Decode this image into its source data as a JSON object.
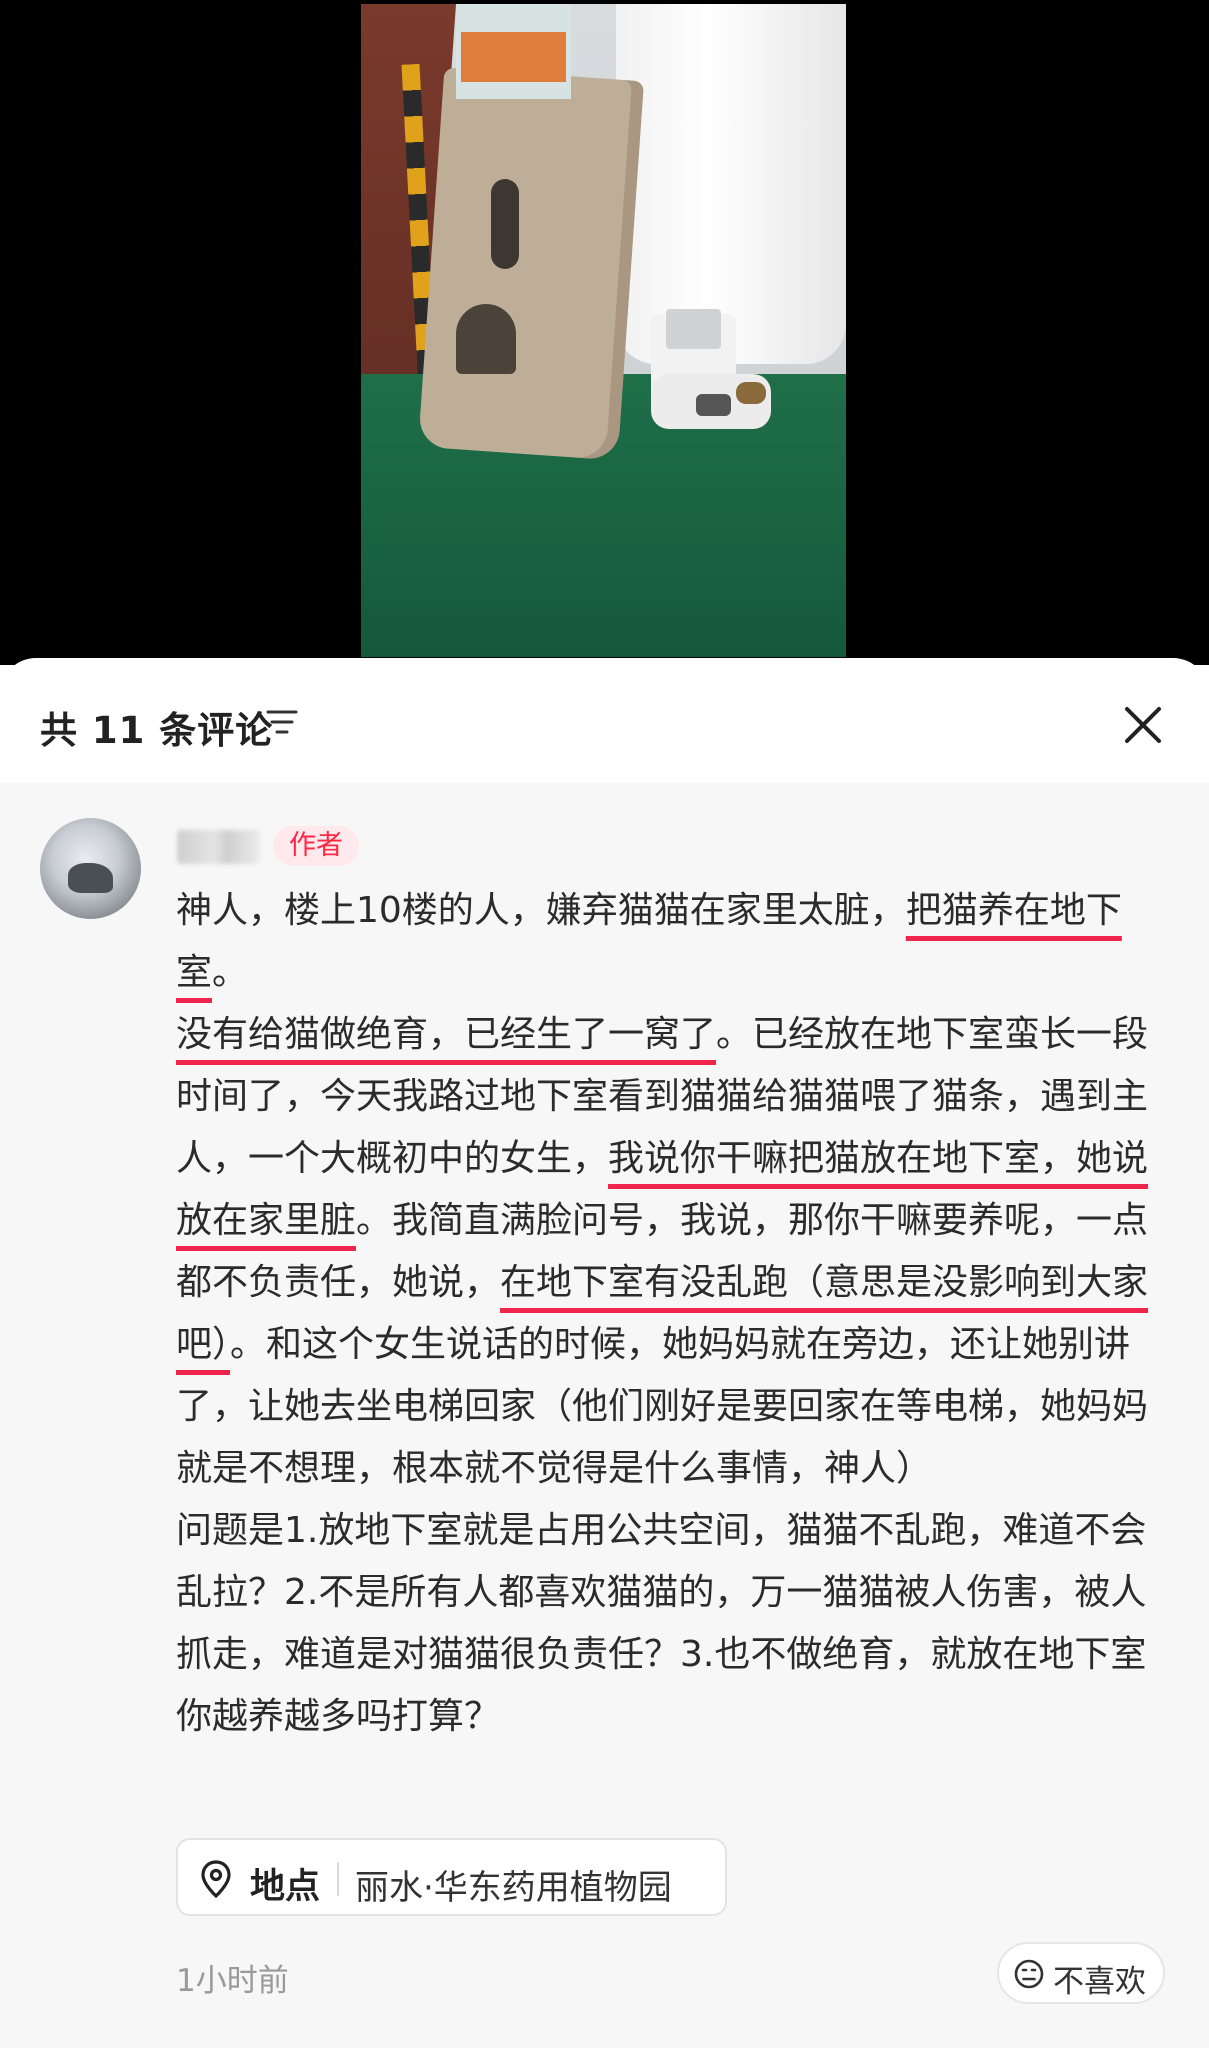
{
  "header": {
    "title": "共 11 条评论",
    "sort_icon": "filter-lines-icon",
    "close_icon": "close-x-icon"
  },
  "comment": {
    "author_badge": "作者",
    "segments": [
      {
        "text": "神人，楼上10楼的人，嫌弃猫猫在家里太脏，",
        "underline": false
      },
      {
        "text": "把猫养在地下室",
        "underline": true
      },
      {
        "text": "。",
        "underline": false,
        "break": true
      },
      {
        "text": "没有给猫做绝育，已经生了一窝了",
        "underline": true
      },
      {
        "text": "。已经放在地下室蛮长一段时间了，今天我路过地下室看到猫猫给猫猫喂了猫条，遇到主人，一个大概初中的女生，",
        "underline": false
      },
      {
        "text": "我说你干嘛把猫放在地下室，她说放在家里脏",
        "underline": true
      },
      {
        "text": "。我简直满脸问号，我说，那你干嘛要养呢，一点都不负责任，她说，",
        "underline": false
      },
      {
        "text": "在地下室有没乱跑（意思是没影响到大家吧）",
        "underline": true
      },
      {
        "text": "。和这个女生说话的时候，她妈妈就在旁边，还让她别讲了，让她去坐电梯回家（他们刚好是要回家在等电梯，她妈妈就是不想理，根本就不觉得是什么事情，神人）",
        "underline": false,
        "break": true
      },
      {
        "text": "问题是1.放地下室就是占用公共空间，猫猫不乱跑，难道不会乱拉？2.不是所有人都喜欢猫猫的，万一猫猫被人伤害，被人抓走，难道是对猫猫很负责任？3.也不做绝育，就放在地下室你越养越多吗打算？",
        "underline": false
      }
    ],
    "location": {
      "icon": "location-pin-icon",
      "label": "地点",
      "value": "丽水·华东药用植物园"
    },
    "time": "1小时前",
    "dislike": {
      "icon": "frown-face-icon",
      "label": "不喜欢"
    }
  },
  "colors": {
    "accent_red": "#ff2741",
    "underline_red": "#f0254b",
    "video_bg": "#000000",
    "comment_bg": "#f7f7f7"
  }
}
